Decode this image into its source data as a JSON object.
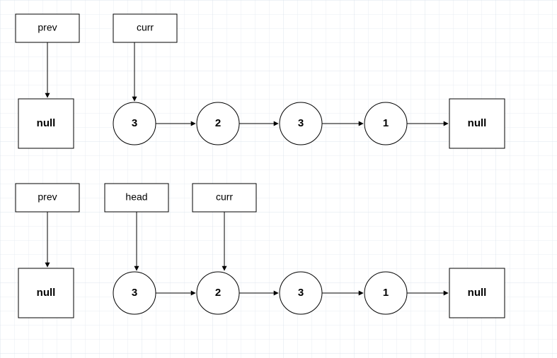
{
  "row1": {
    "ptr_prev": "prev",
    "ptr_curr": "curr",
    "null_left": "null",
    "n1": "3",
    "n2": "2",
    "n3": "3",
    "n4": "1",
    "null_right": "null"
  },
  "row2": {
    "ptr_prev": "prev",
    "ptr_head": "head",
    "ptr_curr": "curr",
    "null_left": "null",
    "n1": "3",
    "n2": "2",
    "n3": "3",
    "n4": "1",
    "null_right": "null"
  }
}
